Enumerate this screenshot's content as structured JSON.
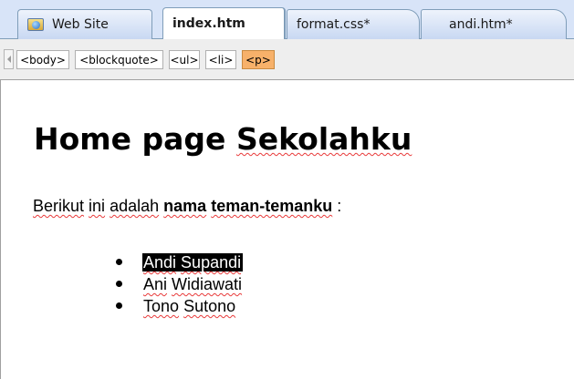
{
  "tabs": [
    {
      "label": "Web Site",
      "icon": "website-folder-icon",
      "active": false
    },
    {
      "label": "index.htm",
      "active": true
    },
    {
      "label": "format.css*",
      "active": false
    },
    {
      "label": "andi.htm*",
      "active": false
    }
  ],
  "tag_selector": {
    "tags": [
      "<body>",
      "<blockquote>",
      "<ul>",
      "<li>",
      "<p>"
    ],
    "selected": "<p>",
    "selected_color": "#f7b16a"
  },
  "document": {
    "heading": {
      "word1": "Home page",
      "word2": "Sekolahku"
    },
    "intro": {
      "w1": "Berikut",
      "w2": "ini",
      "w3": "adalah",
      "w4": "nama",
      "w5": "teman-temanku",
      "w6": ":"
    },
    "friends": [
      {
        "first": "Andi",
        "last": "Supandi",
        "selected": true
      },
      {
        "first": "Ani",
        "last": "Widiawati",
        "selected": false
      },
      {
        "first": "Tono",
        "last": "Sutono",
        "selected": false
      }
    ]
  },
  "colors": {
    "spellcheck_underline": "#e83a3a",
    "tab_strip_background": "#d8e4f8"
  }
}
